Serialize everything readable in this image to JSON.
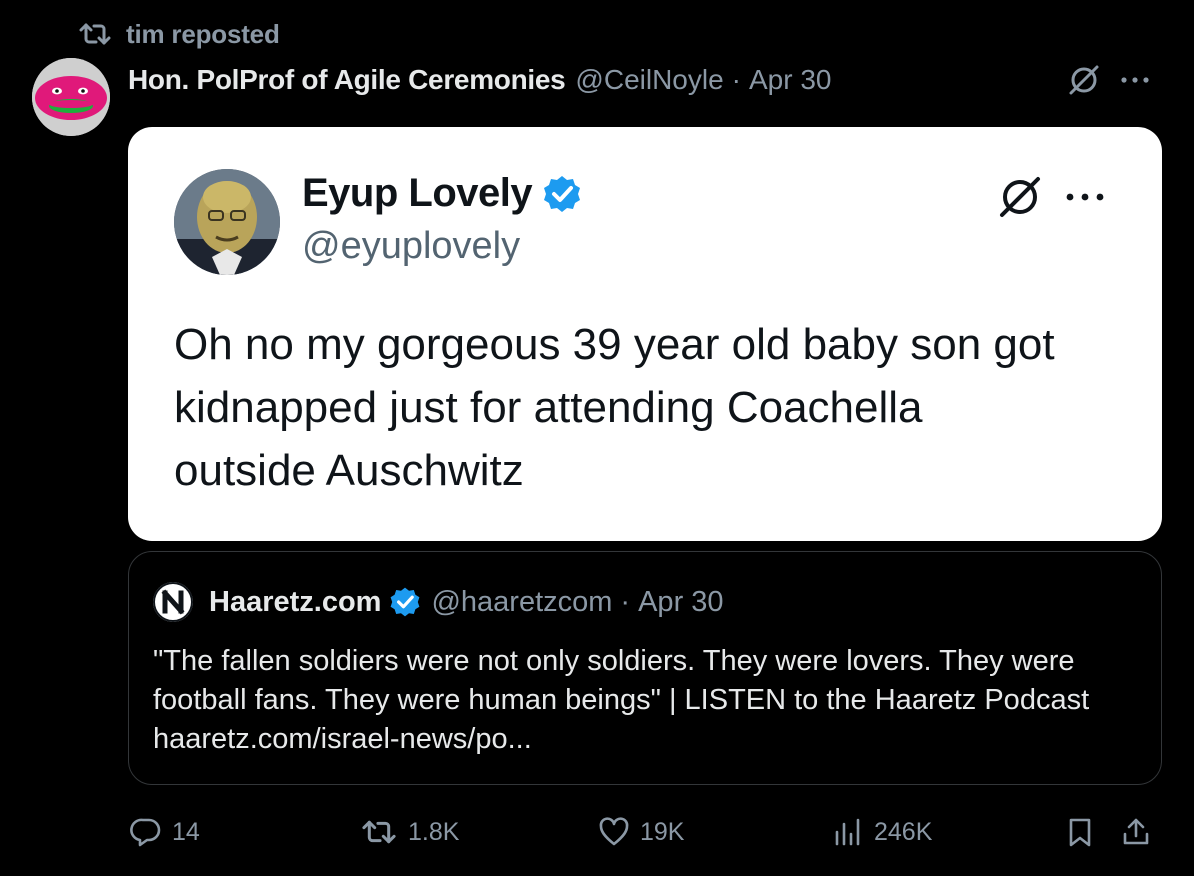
{
  "repost": {
    "text": "tim reposted",
    "icon": "repost-icon"
  },
  "post": {
    "author_name": "Hon. PolProf of Agile Ceremonies",
    "handle": "@CeilNoyle",
    "separator": "·",
    "date": "Apr 30",
    "icons": [
      "grok-icon",
      "more-icon"
    ]
  },
  "embedded": {
    "author_name": "Eyup Lovely",
    "handle": "@eyuplovely",
    "body_lines": [
      "Oh no my gorgeous 39 year old baby son got",
      "kidnapped just for attending Coachella",
      "outside Auschwitz"
    ],
    "icons": [
      "verified-badge-icon",
      "grok-icon",
      "more-icon"
    ]
  },
  "quoted": {
    "author_name": "Haaretz.com",
    "handle": "@haaretzcom",
    "separator": "·",
    "date": "Apr 30",
    "body_lines": [
      "\"The fallen soldiers were not only soldiers. They were lovers. They were",
      "football fans. They were human beings\" | LISTEN to the Haaretz Podcast",
      "haaretz.com/israel-news/po..."
    ],
    "icons": [
      "haaretz-logo-icon",
      "verified-badge-icon"
    ]
  },
  "actions": {
    "replies": "14",
    "reposts": "1.8K",
    "likes": "19K",
    "views": "246K"
  },
  "colors": {
    "background": "#000000",
    "text_primary": "#e7e9ea",
    "text_secondary": "#8b98a5",
    "verified_blue": "#1d9bf0",
    "card_border": "#333639"
  }
}
